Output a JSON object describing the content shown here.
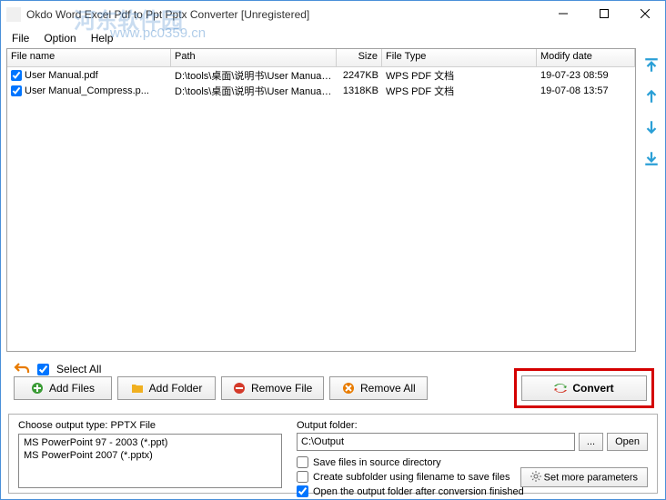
{
  "window": {
    "title": "Okdo Word Excel Pdf to Ppt Pptx Converter [Unregistered]"
  },
  "menu": {
    "file": "File",
    "option": "Option",
    "help": "Help"
  },
  "watermark": {
    "text": "河东软件园",
    "url": "www.pc0359.cn"
  },
  "table": {
    "headers": {
      "name": "File name",
      "path": "Path",
      "size": "Size",
      "type": "File Type",
      "date": "Modify date"
    },
    "rows": [
      {
        "name": "User Manual.pdf",
        "path": "D:\\tools\\桌面\\说明书\\User Manual.pdf",
        "size": "2247KB",
        "type": "WPS PDF 文档",
        "date": "19-07-23 08:59"
      },
      {
        "name": "User Manual_Compress.p...",
        "path": "D:\\tools\\桌面\\说明书\\User Manual_C...",
        "size": "1318KB",
        "type": "WPS PDF 文档",
        "date": "19-07-08 13:57"
      }
    ]
  },
  "selectAll": "Select All",
  "buttons": {
    "addFiles": "Add Files",
    "addFolder": "Add Folder",
    "removeFile": "Remove File",
    "removeAll": "Remove All",
    "convert": "Convert"
  },
  "output": {
    "typeLabel": "Choose output type:",
    "typeValue": "PPTX File",
    "types": [
      "MS PowerPoint 97 - 2003 (*.ppt)",
      "MS PowerPoint 2007 (*.pptx)"
    ],
    "folderLabel": "Output folder:",
    "folderValue": "C:\\Output",
    "browse": "...",
    "open": "Open",
    "saveInSource": "Save files in source directory",
    "createSub": "Create subfolder using filename to save files",
    "openAfter": "Open the output folder after conversion finished",
    "moreParams": "Set more parameters"
  }
}
